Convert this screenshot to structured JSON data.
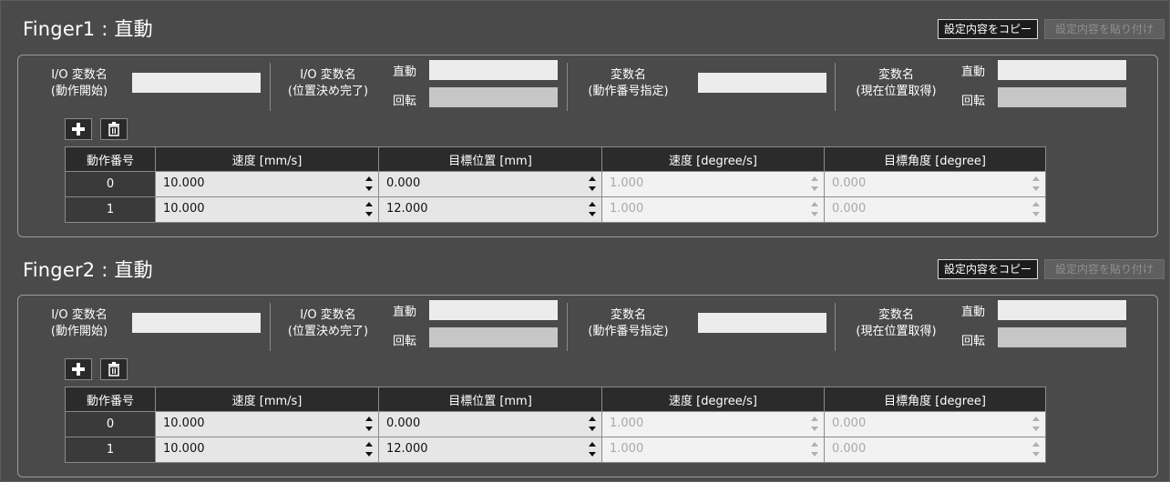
{
  "sections": [
    {
      "title": "Finger1 : 直動",
      "copy_label": "設定内容をコピー",
      "paste_label": "設定内容を貼り付け",
      "io_start": {
        "line1": "I/O 変数名",
        "line2": "(動作開始)"
      },
      "io_done": {
        "line1": "I/O 変数名",
        "line2": "(位置決め完了)",
        "linear": "直動",
        "rotate": "回転"
      },
      "var_num": {
        "line1": "変数名",
        "line2": "(動作番号指定)"
      },
      "var_pos": {
        "line1": "変数名",
        "line2": "(現在位置取得)",
        "linear": "直動",
        "rotate": "回転"
      },
      "add_icon": "plus-icon",
      "delete_icon": "trash-icon",
      "table": {
        "headers": [
          "動作番号",
          "速度 [mm/s]",
          "目標位置 [mm]",
          "速度 [degree/s]",
          "目標角度 [degree]"
        ],
        "rows": [
          {
            "no": "0",
            "speed": "10.000",
            "pos": "0.000",
            "deg_speed": "1.000",
            "angle": "0.000"
          },
          {
            "no": "1",
            "speed": "10.000",
            "pos": "12.000",
            "deg_speed": "1.000",
            "angle": "0.000"
          }
        ]
      }
    },
    {
      "title": "Finger2 : 直動",
      "copy_label": "設定内容をコピー",
      "paste_label": "設定内容を貼り付け",
      "io_start": {
        "line1": "I/O 変数名",
        "line2": "(動作開始)"
      },
      "io_done": {
        "line1": "I/O 変数名",
        "line2": "(位置決め完了)",
        "linear": "直動",
        "rotate": "回転"
      },
      "var_num": {
        "line1": "変数名",
        "line2": "(動作番号指定)"
      },
      "var_pos": {
        "line1": "変数名",
        "line2": "(現在位置取得)",
        "linear": "直動",
        "rotate": "回転"
      },
      "add_icon": "plus-icon",
      "delete_icon": "trash-icon",
      "table": {
        "headers": [
          "動作番号",
          "速度 [mm/s]",
          "目標位置 [mm]",
          "速度 [degree/s]",
          "目標角度 [degree]"
        ],
        "rows": [
          {
            "no": "0",
            "speed": "10.000",
            "pos": "0.000",
            "deg_speed": "1.000",
            "angle": "0.000"
          },
          {
            "no": "1",
            "speed": "10.000",
            "pos": "12.000",
            "deg_speed": "1.000",
            "angle": "0.000"
          }
        ]
      }
    }
  ],
  "colors": {
    "background": "#4a4a4a",
    "header_cell": "#2b2b2b",
    "input_light": "#ececec",
    "input_gray": "#c6c6c6",
    "disabled_text": "#a9a9a9"
  }
}
